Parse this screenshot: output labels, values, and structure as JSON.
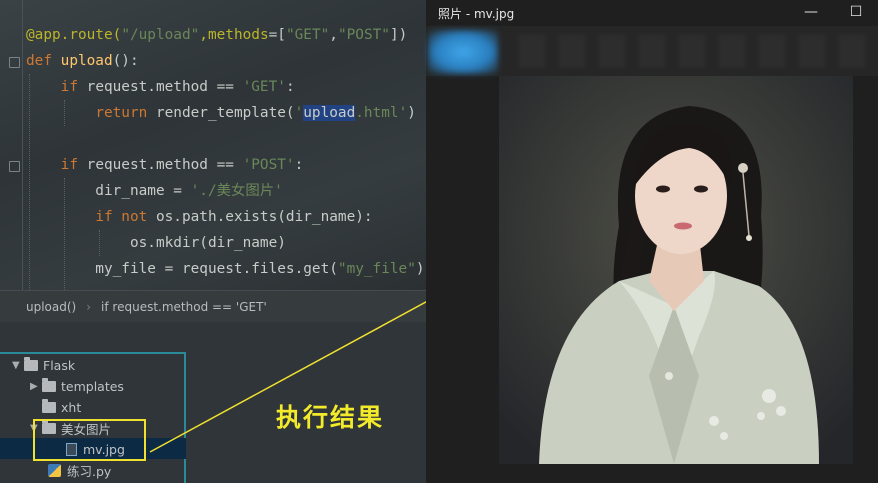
{
  "editor": {
    "lines": [
      {
        "id": "l1",
        "parts": [
          [
            "dec",
            "@app.route("
          ],
          [
            "str",
            "\"/upload\""
          ],
          [
            "dec",
            ","
          ],
          [
            "dec",
            "methods"
          ],
          [
            "txt",
            "=["
          ],
          [
            "str",
            "\"GET\""
          ],
          [
            "txt",
            ","
          ],
          [
            "str",
            "\"POST\""
          ],
          [
            "txt",
            "])"
          ]
        ]
      },
      {
        "id": "l2",
        "parts": [
          [
            "kw",
            "def "
          ],
          [
            "fn",
            "upload"
          ],
          [
            "txt",
            "():"
          ]
        ]
      },
      {
        "id": "l3",
        "parts": [
          [
            "txt",
            "    "
          ],
          [
            "kw",
            "if "
          ],
          [
            "txt",
            "request.method == "
          ],
          [
            "str",
            "'GET'"
          ],
          [
            "txt",
            ":"
          ]
        ]
      },
      {
        "id": "l4",
        "parts": [
          [
            "txt",
            "        "
          ],
          [
            "kw",
            "return "
          ],
          [
            "txt",
            "render_template("
          ],
          [
            "str",
            "'"
          ],
          [
            "sel",
            "upload"
          ],
          [
            "str",
            ".html'"
          ],
          [
            "txt",
            ")"
          ]
        ]
      },
      {
        "id": "l5",
        "parts": [
          [
            "txt",
            ""
          ]
        ]
      },
      {
        "id": "l6",
        "parts": [
          [
            "txt",
            "    "
          ],
          [
            "kw",
            "if "
          ],
          [
            "txt",
            "request.method == "
          ],
          [
            "str",
            "'POST'"
          ],
          [
            "txt",
            ":"
          ]
        ]
      },
      {
        "id": "l7",
        "parts": [
          [
            "txt",
            "        dir_name = "
          ],
          [
            "str",
            "'./美女图片'"
          ]
        ]
      },
      {
        "id": "l8",
        "parts": [
          [
            "txt",
            "        "
          ],
          [
            "kw",
            "if not "
          ],
          [
            "txt",
            "os.path.exists(dir_name):"
          ]
        ]
      },
      {
        "id": "l9",
        "parts": [
          [
            "txt",
            "            os.mkdir(dir_name)"
          ]
        ]
      },
      {
        "id": "l10",
        "parts": [
          [
            "txt",
            "        my_file = request.files.get("
          ],
          [
            "str",
            "\"my_file\""
          ],
          [
            "txt",
            ")"
          ]
        ]
      }
    ],
    "breadcrumb": {
      "func": "upload()",
      "cond": "if request.method == 'GET'"
    }
  },
  "tree": {
    "root": "Flask",
    "items": [
      {
        "label": "templates",
        "kind": "folder",
        "arrow": "▶"
      },
      {
        "label": "xht",
        "kind": "folder",
        "arrow": ""
      },
      {
        "label": "美女图片",
        "kind": "folder",
        "arrow": "▼"
      },
      {
        "label": "mv.jpg",
        "kind": "image"
      },
      {
        "label": "练习.py",
        "kind": "python"
      }
    ]
  },
  "annotation": {
    "label": "执行结果",
    "color": "#f2ea2a"
  },
  "viewer": {
    "title": "照片 - mv.jpg",
    "minimize": "—",
    "maximize": "☐"
  },
  "colors": {
    "accent": "#2a8a9a",
    "highlight": "#f0e030",
    "selection": "#214283"
  }
}
